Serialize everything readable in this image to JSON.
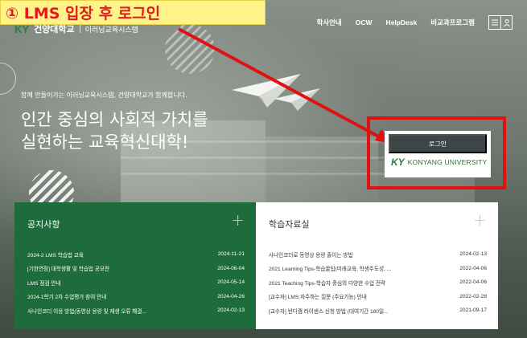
{
  "annotation": {
    "title": "① LMS 입장 후 로그인"
  },
  "header": {
    "logo_mark": "KY",
    "logo_text": "건양대학교",
    "logo_sub": "이러닝교육시스템",
    "nav": [
      "학사안내",
      "OCW",
      "HelpDesk",
      "비교과프로그램"
    ],
    "menu_icon": "menu-icon",
    "user_icon": "user-icon"
  },
  "hero": {
    "tagline": "함께 만들어가는 이러닝교육시스템, 건양대학교가 함께합니다.",
    "headline_line1": "인간 중심의 사회적 가치를",
    "headline_line2": "실현하는 교육혁신대학!"
  },
  "login": {
    "button_label": "로그인",
    "logo_mark": "KY",
    "logo_text": "KONYANG UNIVERSITY"
  },
  "colors": {
    "annotation_red": "#e01111",
    "annotation_yellow": "#fff38a",
    "brand_green": "#1e6b3c",
    "login_button": "#3d4646"
  },
  "notices": {
    "title": "공지사항",
    "items": [
      {
        "title": "2024-2 LMS 학습법 교육",
        "date": "2024-11-21"
      },
      {
        "title": "[기한연장] 대학생활 및 학습법 공모전",
        "date": "2024-06-04"
      },
      {
        "title": "LMS 점검 안내",
        "date": "2024-05-14"
      },
      {
        "title": "2024-1학기 2차 수업평가 참여 안내",
        "date": "2024-04-26"
      },
      {
        "title": "사나인코더 이용 방법(동영상 용량 및 재생 오류 해결...",
        "date": "2024-02-13"
      }
    ]
  },
  "resources": {
    "title": "학습자료실",
    "items": [
      {
        "title": "사나인코더로 동영상 용량 줄이는 방법",
        "date": "2024-02-13"
      },
      {
        "title": "2021 Learning Tips-학습꿀팁(미래교육, 학생주도성, ...",
        "date": "2022-04-06"
      },
      {
        "title": "2021 Teaching Tips-학습자 중심의 다양한 수업 전략",
        "date": "2022-04-06"
      },
      {
        "title": "[교수자] LMS 자주하는 질문 (주요기능) 안내",
        "date": "2022-02-28"
      },
      {
        "title": "[교수자] 반디캠 라이센스 신청 방법 (대여기간 180일...",
        "date": "2021-09-17"
      }
    ]
  }
}
